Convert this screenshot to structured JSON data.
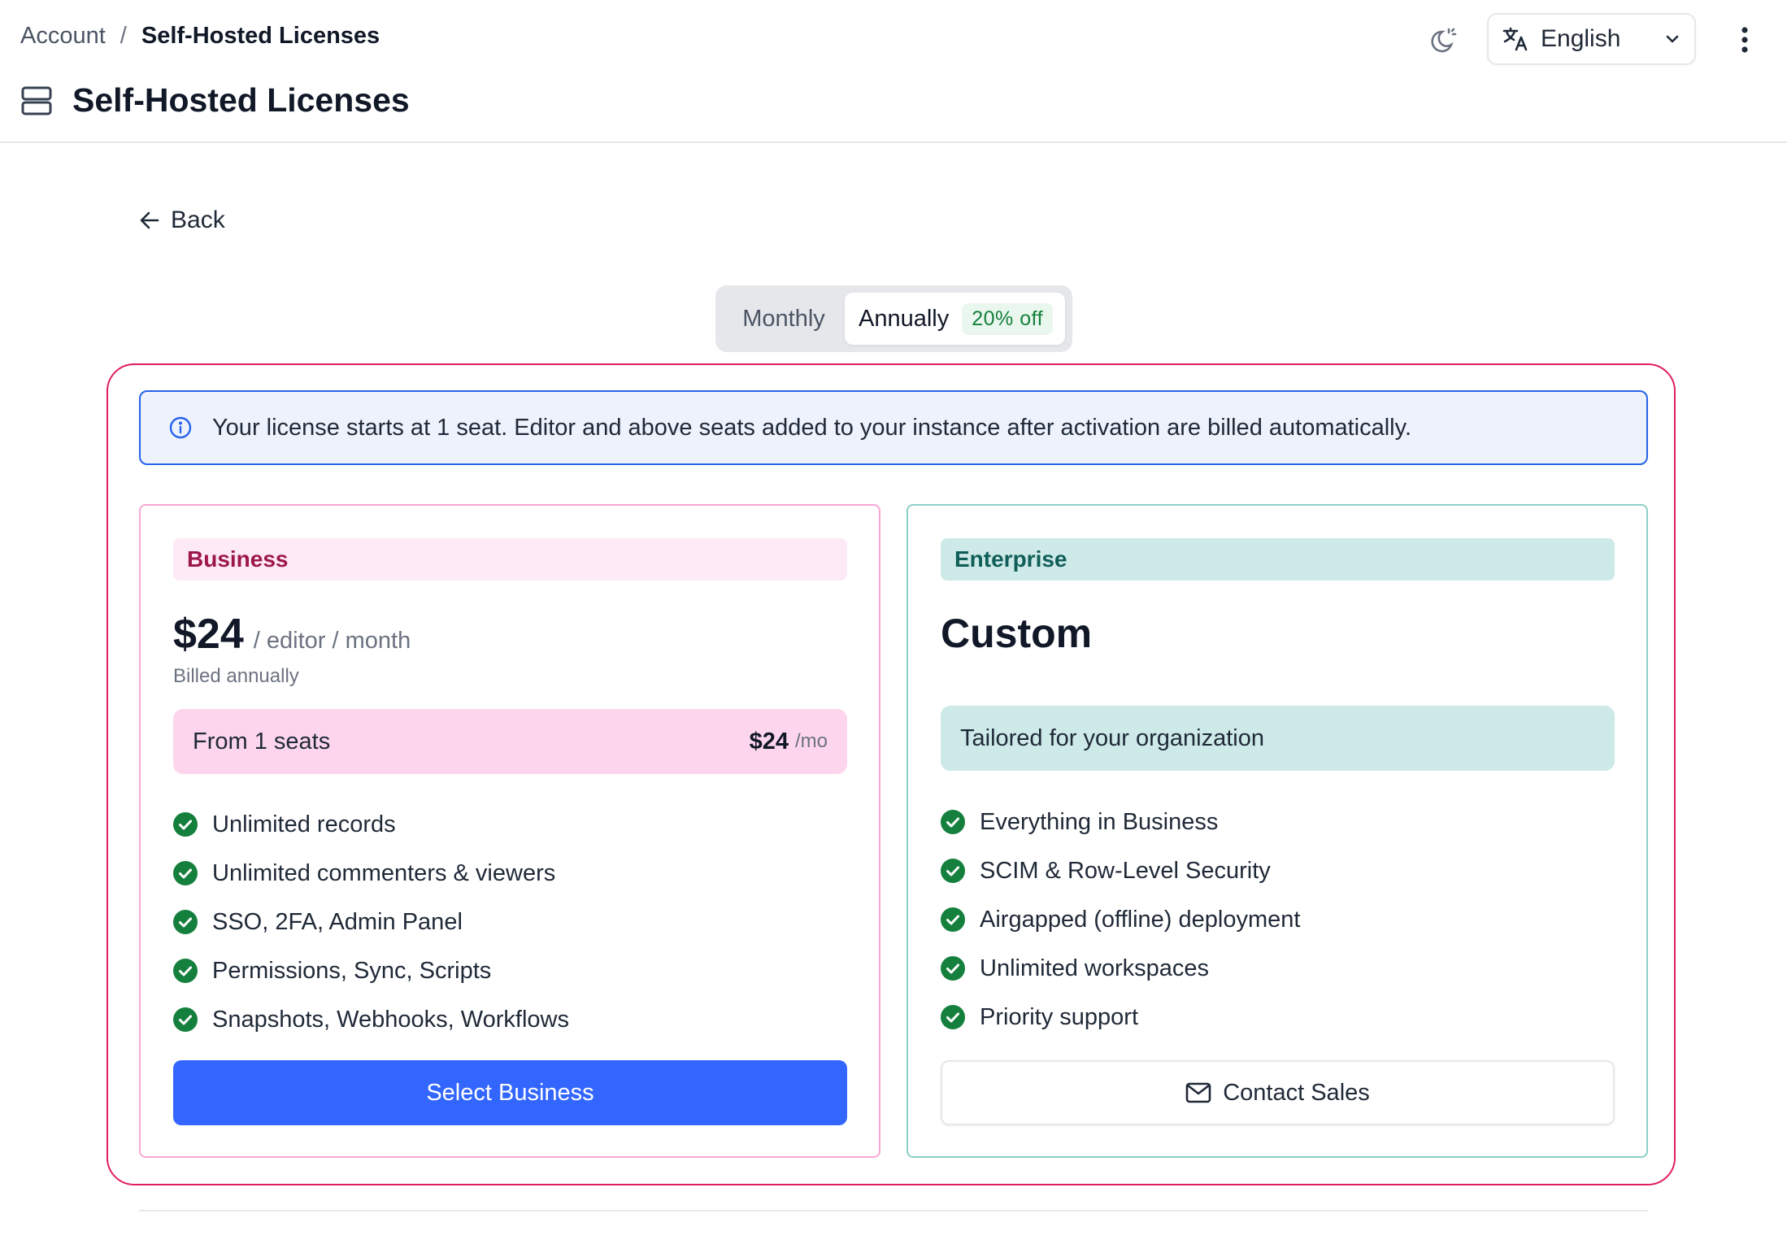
{
  "breadcrumb": {
    "root": "Account",
    "separator": "/",
    "current": "Self-Hosted Licenses"
  },
  "page": {
    "title": "Self-Hosted Licenses",
    "icon": "server-icon"
  },
  "header": {
    "theme_icon": "theme-toggle-icon",
    "language": "English",
    "more_icon": "more-vertical-icon"
  },
  "back": {
    "label": "Back"
  },
  "billing_toggle": {
    "monthly": "Monthly",
    "annually": "Annually",
    "discount": "20% off",
    "selected": "annually"
  },
  "info_banner": {
    "text": "Your license starts at 1 seat. Editor and above seats added to your instance after activation are billed automatically."
  },
  "plans": {
    "business": {
      "tag": "Business",
      "price": "$24",
      "price_unit": "/ editor / month",
      "billed": "Billed annually",
      "seats_label": "From 1 seats",
      "seats_price": "$24",
      "seats_unit": "/mo",
      "features": [
        "Unlimited records",
        "Unlimited commenters & viewers",
        "SSO, 2FA, Admin Panel",
        "Permissions, Sync, Scripts",
        "Snapshots, Webhooks, Workflows"
      ],
      "cta": "Select Business"
    },
    "enterprise": {
      "tag": "Enterprise",
      "price": "Custom",
      "tailored": "Tailored for your organization",
      "features": [
        "Everything in Business",
        "SCIM & Row-Level Security",
        "Airgapped (offline) deployment",
        "Unlimited workspaces",
        "Priority support"
      ],
      "cta": "Contact Sales"
    }
  },
  "colors": {
    "accent": "#3366ff",
    "highlight_border": "#e11d63",
    "business_border": "#f9a8d4",
    "enterprise_border": "#8ccfc6",
    "check_green": "#15803d"
  }
}
